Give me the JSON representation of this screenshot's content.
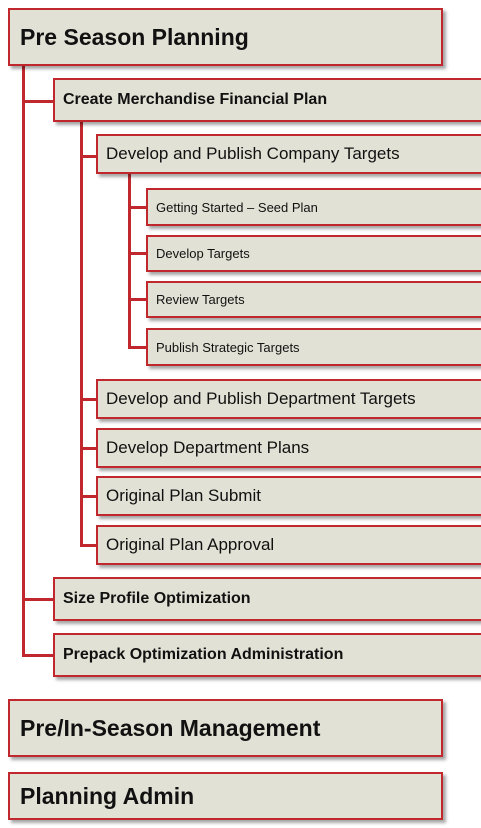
{
  "nodes": {
    "pre_season_planning": "Pre Season Planning",
    "create_merchandise_financial_plan": "Create Merchandise Financial Plan",
    "develop_publish_company_targets": "Develop and Publish Company Targets",
    "getting_started_seed_plan": "Getting Started – Seed Plan",
    "develop_targets": "Develop Targets",
    "review_targets": "Review Targets",
    "publish_strategic_targets": "Publish Strategic Targets",
    "develop_publish_department_targets": "Develop and Publish Department Targets",
    "develop_department_plans": "Develop Department Plans",
    "original_plan_submit": "Original Plan Submit",
    "original_plan_approval": "Original Plan Approval",
    "size_profile_optimization": "Size Profile Optimization",
    "prepack_optimization_administration": "Prepack Optimization Administration",
    "pre_in_season_management": "Pre/In-Season Management",
    "planning_admin": "Planning Admin"
  },
  "colors": {
    "border": "#c0282d",
    "box_fill": "#e1e1d5",
    "text": "#111111"
  }
}
